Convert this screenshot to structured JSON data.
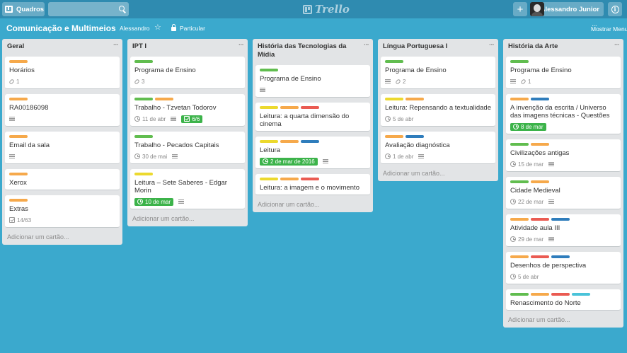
{
  "header": {
    "boards_label": "Quadros",
    "logo_text": "Trello",
    "user_name": "Alessandro Junior"
  },
  "board": {
    "title": "Comunicação e Multimeios",
    "owner": "Alessandro",
    "visibility": "Particular",
    "show_menu": "Mostrar Menu"
  },
  "add_card_label": "Adicionar um cartão...",
  "label_colors": {
    "green": "#61bd4f",
    "orange": "#f6a94b",
    "yellow": "#ecd92e",
    "red": "#ea5b52",
    "blue": "#2f7dbc",
    "teal": "#4ac3d9"
  },
  "lists": [
    {
      "title": "Geral",
      "cards": [
        {
          "title": "Horários",
          "labels": [
            "orange"
          ],
          "attachments": "1"
        },
        {
          "title": "RA00186098",
          "labels": [
            "orange"
          ],
          "description": true
        },
        {
          "title": "Email da sala",
          "labels": [
            "orange"
          ],
          "description": true
        },
        {
          "title": "Xerox",
          "labels": [
            "orange"
          ]
        },
        {
          "title": "Extras",
          "labels": [
            "orange"
          ],
          "checklist": "14/63"
        }
      ]
    },
    {
      "title": "IPT I",
      "cards": [
        {
          "title": "Programa de Ensino",
          "labels": [
            "green"
          ],
          "attachments": "3"
        },
        {
          "title": "Trabalho - Tzvetan Todorov",
          "labels": [
            "green",
            "orange"
          ],
          "due": "11 de abr",
          "description": true,
          "checklist": "6/6",
          "checklist_complete": true
        },
        {
          "title": "Trabalho - Pecados Capitais",
          "labels": [
            "green"
          ],
          "due": "30 de mai",
          "description": true
        },
        {
          "title": "Leitura – Sete Saberes - Edgar Morin",
          "labels": [
            "yellow"
          ],
          "due": "10 de mar",
          "due_complete": true,
          "description": true
        }
      ]
    },
    {
      "title": "História das Tecnologias da Mídia",
      "cards": [
        {
          "title": "Programa de Ensino",
          "labels": [
            "green"
          ],
          "description": true
        },
        {
          "title": "Leitura: a quarta dimensão do cinema",
          "labels": [
            "yellow",
            "orange",
            "red"
          ]
        },
        {
          "title": "Leitura",
          "labels": [
            "yellow",
            "orange",
            "blue"
          ],
          "due": "2 de mar de 2016",
          "due_complete": true,
          "description": true
        },
        {
          "title": "Leitura: a imagem e o movimento",
          "labels": [
            "yellow",
            "orange",
            "red"
          ]
        }
      ]
    },
    {
      "title": "Língua Portuguesa I",
      "cards": [
        {
          "title": "Programa de Ensino",
          "labels": [
            "green"
          ],
          "description": true,
          "attachments": "2"
        },
        {
          "title": "Leitura: Repensando a textualidade",
          "labels": [
            "yellow",
            "orange"
          ],
          "due": "5 de abr"
        },
        {
          "title": "Avaliação diagnóstica",
          "labels": [
            "orange",
            "blue"
          ],
          "due": "1 de abr",
          "description": true
        }
      ]
    },
    {
      "title": "História da Arte",
      "cards": [
        {
          "title": "Programa de Ensino",
          "labels": [
            "green"
          ],
          "description": true,
          "attachments": "1"
        },
        {
          "title": "A invenção da escrita / Universo das imagens técnicas - Questões",
          "labels": [
            "orange",
            "blue"
          ],
          "due": "8 de mar",
          "due_complete": true
        },
        {
          "title": "Civilizações antigas",
          "labels": [
            "green",
            "orange"
          ],
          "due": "15 de mar",
          "description": true
        },
        {
          "title": "Cidade Medieval",
          "labels": [
            "green",
            "orange"
          ],
          "due": "22 de mar",
          "description": true
        },
        {
          "title": "Atividade aula III",
          "labels": [
            "orange",
            "red",
            "blue"
          ],
          "due": "29 de mar",
          "description": true
        },
        {
          "title": "Desenhos de perspectiva",
          "labels": [
            "orange",
            "red",
            "blue"
          ],
          "due": "5 de abr"
        },
        {
          "title": "Renascimento do Norte",
          "labels": [
            "green",
            "orange",
            "red",
            "teal"
          ]
        }
      ]
    }
  ]
}
